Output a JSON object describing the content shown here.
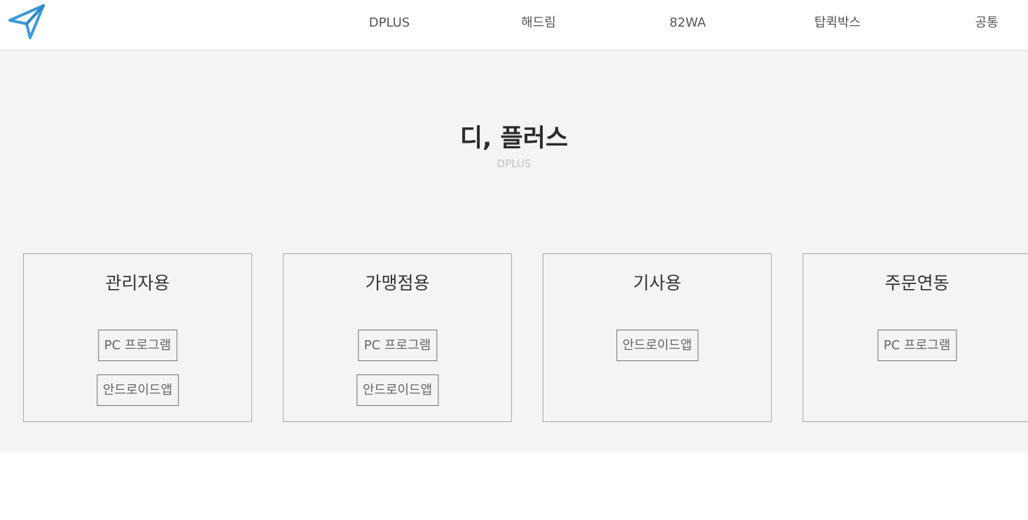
{
  "header": {
    "logo_icon": "paper-plane-icon",
    "nav": [
      {
        "label": "DPLUS"
      },
      {
        "label": "해드림"
      },
      {
        "label": "82WA"
      },
      {
        "label": "탑퀵박스"
      },
      {
        "label": "공통"
      }
    ]
  },
  "hero": {
    "title": "디, 플러스",
    "subtitle": "DPLUS"
  },
  "cards": [
    {
      "title": "관리자용",
      "buttons": [
        "PC 프로그램",
        "안드로이드앱"
      ]
    },
    {
      "title": "가맹점용",
      "buttons": [
        "PC 프로그램",
        "안드로이드앱"
      ]
    },
    {
      "title": "기사용",
      "buttons": [
        "안드로이드앱"
      ]
    },
    {
      "title": "주문연동",
      "buttons": [
        "PC 프로그램"
      ]
    }
  ],
  "colors": {
    "logo_blue": "#3a9ad9",
    "hero_background": "#f4f4f4",
    "border": "#a9a9a9"
  }
}
